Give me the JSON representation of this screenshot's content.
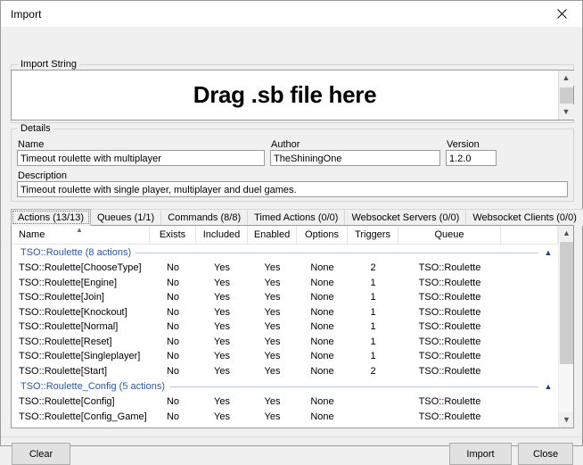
{
  "window": {
    "title": "Import",
    "close_icon": "close-icon"
  },
  "import_string": {
    "group_label": "Import String",
    "drop_text": "Drag .sb file here",
    "scroll_up_icon": "chevron-up-icon",
    "scroll_down_icon": "chevron-down-icon"
  },
  "details": {
    "group_label": "Details",
    "name_label": "Name",
    "name_value": "Timeout roulette with multiplayer",
    "author_label": "Author",
    "author_value": "TheShiningOne",
    "version_label": "Version",
    "version_value": "1.2.0",
    "description_label": "Description",
    "description_value": "Timeout roulette with single player, multiplayer and duel games."
  },
  "tabs": [
    {
      "label": "Actions (13/13)",
      "active": true
    },
    {
      "label": "Queues (1/1)",
      "active": false
    },
    {
      "label": "Commands (8/8)",
      "active": false
    },
    {
      "label": "Timed Actions (0/0)",
      "active": false
    },
    {
      "label": "Websocket Servers (0/0)",
      "active": false
    },
    {
      "label": "Websocket Clients (0/0)",
      "active": false
    }
  ],
  "listview": {
    "columns": [
      "Name",
      "Exists",
      "Included",
      "Enabled",
      "Options",
      "Triggers",
      "Queue"
    ],
    "sort_indicator": "sort-ascending-caret",
    "collapse_icon": "chevron-up-icon",
    "scroll_up_icon": "chevron-up-icon",
    "scroll_down_icon": "chevron-down-icon",
    "groups": [
      {
        "title": "TSO::Roulette (8 actions)",
        "rows": [
          {
            "name": "TSO::Roulette[ChooseType]",
            "exists": "No",
            "included": "Yes",
            "enabled": "Yes",
            "options": "None",
            "triggers": "2",
            "queue": "TSO::Roulette"
          },
          {
            "name": "TSO::Roulette[Engine]",
            "exists": "No",
            "included": "Yes",
            "enabled": "Yes",
            "options": "None",
            "triggers": "1",
            "queue": "TSO::Roulette"
          },
          {
            "name": "TSO::Roulette[Join]",
            "exists": "No",
            "included": "Yes",
            "enabled": "Yes",
            "options": "None",
            "triggers": "1",
            "queue": "TSO::Roulette"
          },
          {
            "name": "TSO::Roulette[Knockout]",
            "exists": "No",
            "included": "Yes",
            "enabled": "Yes",
            "options": "None",
            "triggers": "1",
            "queue": "TSO::Roulette"
          },
          {
            "name": "TSO::Roulette[Normal]",
            "exists": "No",
            "included": "Yes",
            "enabled": "Yes",
            "options": "None",
            "triggers": "1",
            "queue": "TSO::Roulette"
          },
          {
            "name": "TSO::Roulette[Reset]",
            "exists": "No",
            "included": "Yes",
            "enabled": "Yes",
            "options": "None",
            "triggers": "1",
            "queue": "TSO::Roulette"
          },
          {
            "name": "TSO::Roulette[Singleplayer]",
            "exists": "No",
            "included": "Yes",
            "enabled": "Yes",
            "options": "None",
            "triggers": "1",
            "queue": "TSO::Roulette"
          },
          {
            "name": "TSO::Roulette[Start]",
            "exists": "No",
            "included": "Yes",
            "enabled": "Yes",
            "options": "None",
            "triggers": "2",
            "queue": "TSO::Roulette"
          }
        ]
      },
      {
        "title": "TSO::Roulette_Config (5 actions)",
        "rows": [
          {
            "name": "TSO::Roulette[Config]",
            "exists": "No",
            "included": "Yes",
            "enabled": "Yes",
            "options": "None",
            "triggers": "",
            "queue": "TSO::Roulette"
          },
          {
            "name": "TSO::Roulette[Config_Game]",
            "exists": "No",
            "included": "Yes",
            "enabled": "Yes",
            "options": "None",
            "triggers": "",
            "queue": "TSO::Roulette"
          }
        ]
      }
    ]
  },
  "footer": {
    "clear_label": "Clear",
    "import_label": "Import",
    "close_label": "Close"
  }
}
